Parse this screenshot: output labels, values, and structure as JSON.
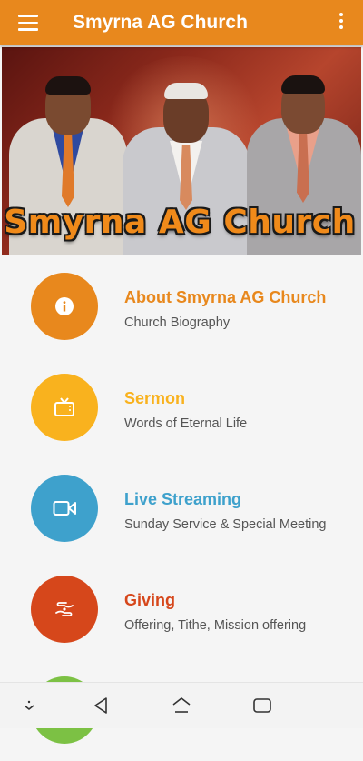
{
  "app_bar": {
    "title": "Smyrna AG Church",
    "menu_icon": "hamburger-menu-icon",
    "overflow_icon": "more-vert-icon",
    "color": "#e8881d"
  },
  "banner": {
    "title": "Smyrna AG Church",
    "title_color": "#f08a1a"
  },
  "menu": [
    {
      "title": "About Smyrna AG Church",
      "subtitle": "Church Biography",
      "icon": "info-icon",
      "color": "#e8881d",
      "title_color": "#e8881d"
    },
    {
      "title": "Sermon",
      "subtitle": "Words of Eternal Life",
      "icon": "tv-icon",
      "color": "#f9b21e",
      "title_color": "#f9b21e"
    },
    {
      "title": "Live Streaming",
      "subtitle": "Sunday Service & Special Meeting",
      "icon": "video-camera-icon",
      "color": "#3ea1cc",
      "title_color": "#3ea1cc"
    },
    {
      "title": "Giving",
      "subtitle": "Offering, Tithe, Mission offering",
      "icon": "giving-hands-icon",
      "color": "#d6471b",
      "title_color": "#d6471b"
    },
    {
      "title": "",
      "subtitle": "",
      "icon": "",
      "color": "#7cc144",
      "title_color": "#7cc144"
    }
  ],
  "nav_bar": {
    "icons": [
      "nav-collapse-icon",
      "back-icon",
      "home-icon",
      "recents-icon"
    ]
  }
}
